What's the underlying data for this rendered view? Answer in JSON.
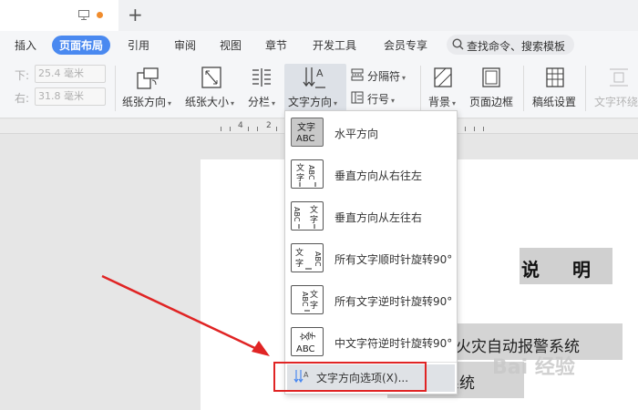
{
  "menu": {
    "items": [
      "插入",
      "页面布局",
      "引用",
      "审阅",
      "视图",
      "章节",
      "开发工具",
      "会员专享"
    ],
    "active": "页面布局",
    "search_placeholder": "查找命令、搜索模板"
  },
  "ribbon": {
    "margin_bottom_label": "下:",
    "margin_bottom_value": "25.4 毫米",
    "margin_right_label": "右:",
    "margin_right_value": "31.8 毫米",
    "orientation": "纸张方向",
    "size": "纸张大小",
    "columns": "分栏",
    "text_direction": "文字方向",
    "breaks": "分隔符",
    "line_numbers": "行号",
    "background": "背景",
    "page_border": "页面边框",
    "draft_paper": "稿纸设置",
    "text_wrap": "文字环绕"
  },
  "ruler": {
    "numbers": [
      "4",
      "2"
    ]
  },
  "dropdown": {
    "items": [
      {
        "label": "水平方向",
        "icon": "horizontal-text-icon",
        "glyph": "文字\nABC"
      },
      {
        "label": "垂直方向从右往左",
        "icon": "vertical-rtl-icon",
        "glyph": "文ABC\n字↓↓"
      },
      {
        "label": "垂直方向从左往右",
        "icon": "vertical-ltr-icon",
        "glyph": "ABC文\n↓↓字"
      },
      {
        "label": "所有文字顺时针旋转90°",
        "icon": "rotate-clockwise-icon",
        "glyph": "文ABC\n字→"
      },
      {
        "label": "所有文字逆时针旋转90°",
        "icon": "rotate-counterclockwise-icon",
        "glyph": "ABC文\n←字"
      },
      {
        "label": "中文字符逆时针旋转90°",
        "icon": "cjk-rotate-icon",
        "glyph": "文字\nABC"
      }
    ],
    "options_label": "文字方向选项(X)..."
  },
  "document": {
    "heading": "说明",
    "line1": "火灾自动报警系统",
    "line2": "火系统"
  },
  "watermark": "Bai 经验",
  "colors": {
    "accent": "#4a89f0",
    "highlight": "#e02424",
    "tab_dot": "#f08c2d"
  }
}
